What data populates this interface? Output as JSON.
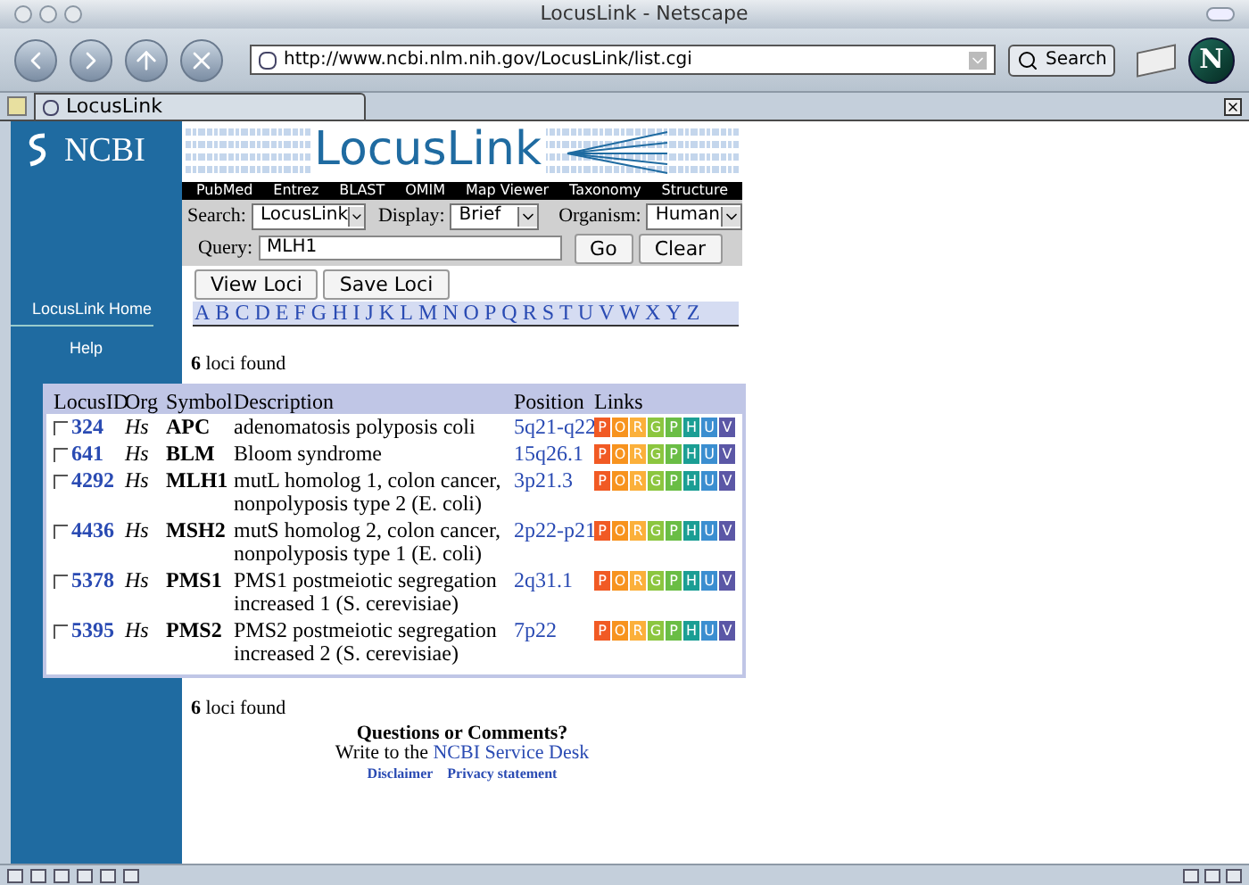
{
  "window": {
    "title": "LocusLink - Netscape"
  },
  "toolbar": {
    "url": "http://www.ncbi.nlm.nih.gov/LocusLink/list.cgi",
    "search_button": "Search",
    "logo_letter": "N"
  },
  "tab": {
    "label": "LocusLink"
  },
  "banner": {
    "org": "NCBI",
    "title": "LocusLink"
  },
  "nav": [
    "PubMed",
    "Entrez",
    "BLAST",
    "OMIM",
    "Map Viewer",
    "Taxonomy",
    "Structure"
  ],
  "form": {
    "search_label": "Search:",
    "search_value": "LocusLink",
    "display_label": "Display:",
    "display_value": "Brief",
    "organism_label": "Organism:",
    "organism_value": "Human",
    "query_label": "Query:",
    "query_value": "MLH1",
    "buttons": [
      "Go",
      "Clear"
    ]
  },
  "actions": [
    "View Loci",
    "Save Loci"
  ],
  "alphabet": [
    "A",
    "B",
    "C",
    "D",
    "E",
    "F",
    "G",
    "H",
    "I",
    "J",
    "K",
    "L",
    "M",
    "N",
    "O",
    "P",
    "Q",
    "R",
    "S",
    "T",
    "U",
    "V",
    "W",
    "X",
    "Y",
    "Z"
  ],
  "sidebar": [
    "LocusLink Home",
    "Help"
  ],
  "count_top": {
    "number": "6",
    "text": "loci found"
  },
  "table": {
    "columns": [
      "LocusID",
      "Org",
      "Symbol",
      "Description",
      "Position",
      "Links"
    ],
    "rows": [
      {
        "checked": false,
        "id": "324",
        "org": "Hs",
        "symbol": "APC",
        "description": "adenomatosis polyposis coli",
        "position": "5q21-q22",
        "links": [
          {
            "label": "P",
            "color": "#f15a24"
          },
          {
            "label": "O",
            "color": "#f7931e"
          },
          {
            "label": "R",
            "color": "#fbb03b"
          },
          {
            "label": "G",
            "color": "#8cc63f"
          },
          {
            "label": "P",
            "color": "#6abd45"
          },
          {
            "label": "H",
            "color": "#1b9e94"
          },
          {
            "label": "U",
            "color": "#3b8ed0"
          },
          {
            "label": "V",
            "color": "#5b57a6"
          }
        ]
      },
      {
        "checked": false,
        "id": "641",
        "org": "Hs",
        "symbol": "BLM",
        "description": "Bloom syndrome",
        "position": "15q26.1",
        "links": [
          {
            "label": "P",
            "color": "#f15a24"
          },
          {
            "label": "O",
            "color": "#f7931e"
          },
          {
            "label": "R",
            "color": "#fbb03b"
          },
          {
            "label": "G",
            "color": "#8cc63f"
          },
          {
            "label": "P",
            "color": "#6abd45"
          },
          {
            "label": "H",
            "color": "#1b9e94"
          },
          {
            "label": "U",
            "color": "#3b8ed0"
          },
          {
            "label": "V",
            "color": "#5b57a6"
          }
        ]
      },
      {
        "checked": false,
        "id": "4292",
        "org": "Hs",
        "symbol": "MLH1",
        "description": "mutL homolog 1, colon cancer, nonpolyposis type 2 (E. coli)",
        "position": "3p21.3",
        "links": [
          {
            "label": "P",
            "color": "#f15a24"
          },
          {
            "label": "O",
            "color": "#f7931e"
          },
          {
            "label": "R",
            "color": "#fbb03b"
          },
          {
            "label": "G",
            "color": "#8cc63f"
          },
          {
            "label": "P",
            "color": "#6abd45"
          },
          {
            "label": "H",
            "color": "#1b9e94"
          },
          {
            "label": "U",
            "color": "#3b8ed0"
          },
          {
            "label": "V",
            "color": "#5b57a6"
          }
        ]
      },
      {
        "checked": false,
        "id": "4436",
        "org": "Hs",
        "symbol": "MSH2",
        "description": "mutS homolog 2, colon cancer, nonpolyposis type 1 (E. coli)",
        "position": "2p22-p21",
        "links": [
          {
            "label": "P",
            "color": "#f15a24"
          },
          {
            "label": "O",
            "color": "#f7931e"
          },
          {
            "label": "R",
            "color": "#fbb03b"
          },
          {
            "label": "G",
            "color": "#8cc63f"
          },
          {
            "label": "P",
            "color": "#6abd45"
          },
          {
            "label": "H",
            "color": "#1b9e94"
          },
          {
            "label": "U",
            "color": "#3b8ed0"
          },
          {
            "label": "V",
            "color": "#5b57a6"
          }
        ]
      },
      {
        "checked": false,
        "id": "5378",
        "org": "Hs",
        "symbol": "PMS1",
        "description": "PMS1 postmeiotic segregation increased 1 (S. cerevisiae)",
        "position": "2q31.1",
        "links": [
          {
            "label": "P",
            "color": "#f15a24"
          },
          {
            "label": "O",
            "color": "#f7931e"
          },
          {
            "label": "R",
            "color": "#fbb03b"
          },
          {
            "label": "G",
            "color": "#8cc63f"
          },
          {
            "label": "P",
            "color": "#6abd45"
          },
          {
            "label": "H",
            "color": "#1b9e94"
          },
          {
            "label": "U",
            "color": "#3b8ed0"
          },
          {
            "label": "V",
            "color": "#5b57a6"
          }
        ]
      },
      {
        "checked": false,
        "id": "5395",
        "org": "Hs",
        "symbol": "PMS2",
        "description": "PMS2 postmeiotic segregation increased 2 (S. cerevisiae)",
        "position": "7p22",
        "links": [
          {
            "label": "P",
            "color": "#f15a24"
          },
          {
            "label": "O",
            "color": "#f7931e"
          },
          {
            "label": "R",
            "color": "#fbb03b"
          },
          {
            "label": "G",
            "color": "#8cc63f"
          },
          {
            "label": "P",
            "color": "#6abd45"
          },
          {
            "label": "H",
            "color": "#1b9e94"
          },
          {
            "label": "U",
            "color": "#3b8ed0"
          },
          {
            "label": "V",
            "color": "#5b57a6"
          }
        ]
      }
    ]
  },
  "count_bottom": {
    "number": "6",
    "text": "loci found"
  },
  "footer": {
    "heading": "Questions or Comments?",
    "write_text": "Write to the",
    "service_link": "NCBI Service Desk",
    "links": [
      "Disclaimer",
      "Privacy statement"
    ]
  }
}
